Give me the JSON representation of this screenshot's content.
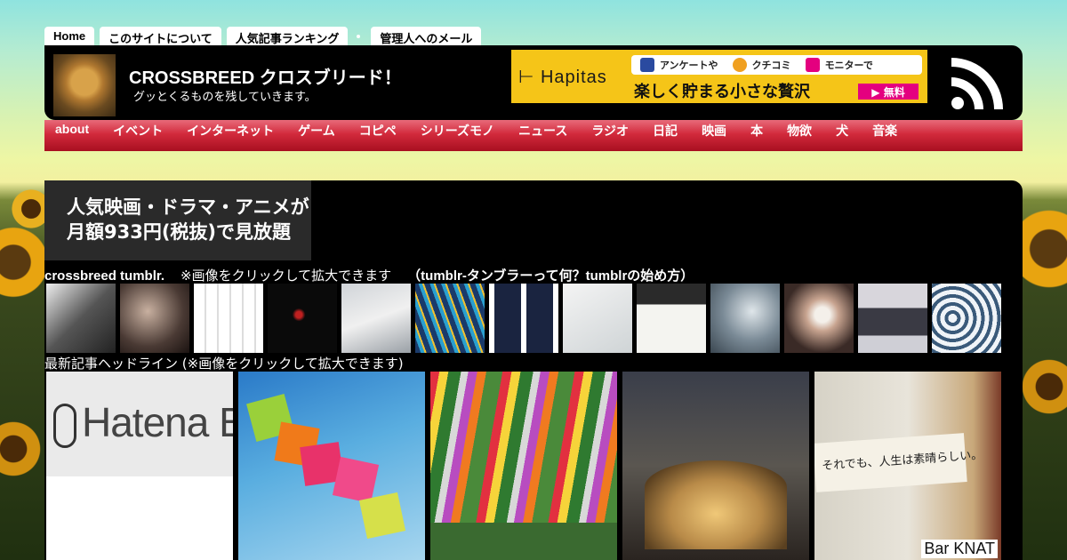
{
  "top_tabs": [
    "Home",
    "このサイトについて",
    "人気記事ランキング",
    "管理人へのメール"
  ],
  "header": {
    "title": "CROSSBREED クロスブリード！",
    "subtitle": "グッとくるものを残していきます。"
  },
  "hapitas_ad": {
    "logo": "Hapitas",
    "item1": "アンケートや",
    "item2": "クチコミ",
    "item3": "モニターで",
    "tagline": "楽しく貯まる小さな贅沢",
    "button": "▶ 無料"
  },
  "categories": [
    "about",
    "イベント",
    "インターネット",
    "ゲーム",
    "コピペ",
    "シリーズモノ",
    "ニュース",
    "ラジオ",
    "日記",
    "映画",
    "本",
    "物欲",
    "犬",
    "音楽"
  ],
  "video_ad": {
    "line1": "人気映画・ドラマ・アニメが",
    "line2": "月額933円(税抜)で見放題"
  },
  "tumblr": {
    "title": "crossbreed tumblr.",
    "note": "※画像をクリックして拡大できます",
    "link": "（tumblr-タンブラーって何？tumblrの始め方）"
  },
  "headlines": {
    "title": "最新記事ヘッドライン (※画像をクリックして拡大できます)",
    "article1_logo": "Hatena Blog",
    "article5_text": "それでも、人生は素晴らしい。",
    "article5_brand": "Bar KNAT"
  },
  "colors": {
    "page_bg_top": "#8fe3df",
    "header_bg": "#000000",
    "nav_red": "#d22a3c",
    "hapitas_yellow": "#f5c518",
    "hapitas_pink": "#e4007f"
  }
}
